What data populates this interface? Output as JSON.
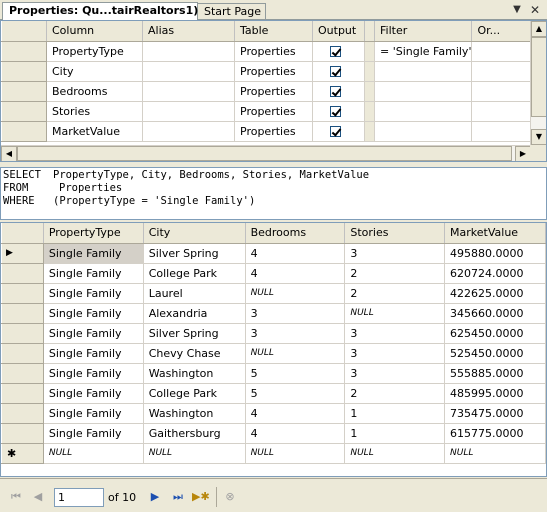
{
  "tabs": [
    {
      "label": "Properties: Qu...tairRealtors1)*"
    },
    {
      "label": "Start Page"
    }
  ],
  "tab_controls": {
    "pin": "▼",
    "close": "✕"
  },
  "criteria": {
    "columns": [
      "Column",
      "Alias",
      "Table",
      "Output",
      "",
      "Filter",
      "Or..."
    ],
    "rows": [
      {
        "column": "PropertyType",
        "alias": "",
        "table": "Properties",
        "output": true,
        "filter": "= 'Single Family'"
      },
      {
        "column": "City",
        "alias": "",
        "table": "Properties",
        "output": true,
        "filter": ""
      },
      {
        "column": "Bedrooms",
        "alias": "",
        "table": "Properties",
        "output": true,
        "filter": ""
      },
      {
        "column": "Stories",
        "alias": "",
        "table": "Properties",
        "output": true,
        "filter": ""
      },
      {
        "column": "MarketValue",
        "alias": "",
        "table": "Properties",
        "output": true,
        "filter": ""
      }
    ]
  },
  "sql": {
    "select_kw": "SELECT",
    "select_val": "PropertyType, City, Bedrooms, Stories, MarketValue",
    "from_kw": "FROM",
    "from_val": "Properties",
    "where_kw": "WHERE",
    "where_val": "(PropertyType = 'Single Family')"
  },
  "results": {
    "columns": [
      "PropertyType",
      "City",
      "Bedrooms",
      "Stories",
      "MarketValue"
    ],
    "rows": [
      [
        "Single Family",
        "Silver Spring",
        "4",
        "3",
        "495880.0000"
      ],
      [
        "Single Family",
        "College Park",
        "4",
        "2",
        "620724.0000"
      ],
      [
        "Single Family",
        "Laurel",
        "NULL",
        "2",
        "422625.0000"
      ],
      [
        "Single Family",
        "Alexandria",
        "3",
        "NULL",
        "345660.0000"
      ],
      [
        "Single Family",
        "Silver Spring",
        "3",
        "3",
        "625450.0000"
      ],
      [
        "Single Family",
        "Chevy Chase",
        "NULL",
        "3",
        "525450.0000"
      ],
      [
        "Single Family",
        "Washington",
        "5",
        "3",
        "555885.0000"
      ],
      [
        "Single Family",
        "College Park",
        "5",
        "2",
        "485995.0000"
      ],
      [
        "Single Family",
        "Washington",
        "4",
        "1",
        "735475.0000"
      ],
      [
        "Single Family",
        "Gaithersburg",
        "4",
        "1",
        "615775.0000"
      ]
    ],
    "new_row": [
      "NULL",
      "NULL",
      "NULL",
      "NULL",
      "NULL"
    ],
    "current_row_marker": "▶",
    "new_row_marker": "✱"
  },
  "navigator": {
    "current": "1",
    "of_label": "of 10"
  }
}
